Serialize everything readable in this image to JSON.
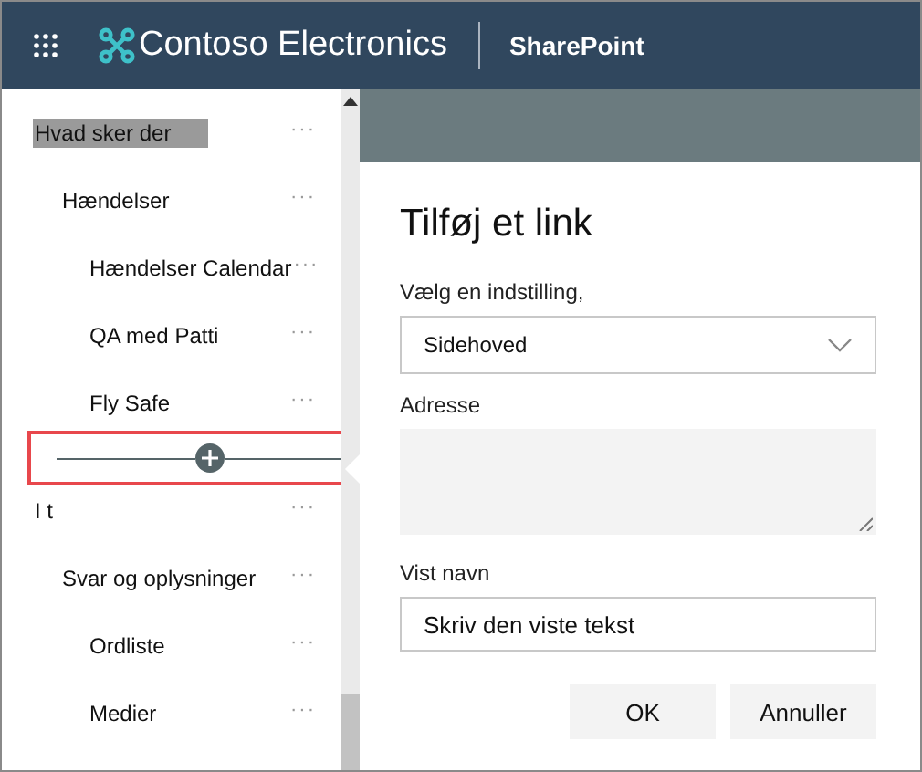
{
  "header": {
    "site_name": "Contoso Electronics",
    "app_name": "SharePoint"
  },
  "nav": {
    "items": [
      {
        "label": "Hvad sker der",
        "selected": true,
        "children": [
          {
            "label": "Hændelser",
            "selected": false,
            "children": [
              {
                "label": "Hændelser Calendar",
                "selected": false
              },
              {
                "label": "QA med Patti",
                "selected": false
              },
              {
                "label": "Fly Safe",
                "selected": false
              }
            ]
          }
        ]
      },
      {
        "label": "I t",
        "selected": false,
        "children": [
          {
            "label": "Svar og oplysninger",
            "selected": false,
            "children": [
              {
                "label": "Ordliste",
                "selected": false
              },
              {
                "label": "Medier",
                "selected": false
              }
            ]
          }
        ]
      }
    ],
    "more_label": "···",
    "insert_control": {
      "highlighted": true
    }
  },
  "dialog": {
    "title": "Tilføj et link",
    "option_label": "Vælg en indstilling,",
    "option_value": "Sidehoved",
    "address_label": "Adresse",
    "display_label": "Vist navn",
    "display_placeholder": "Skriv den viste tekst",
    "buttons": [
      "OK",
      "Annuller"
    ]
  }
}
